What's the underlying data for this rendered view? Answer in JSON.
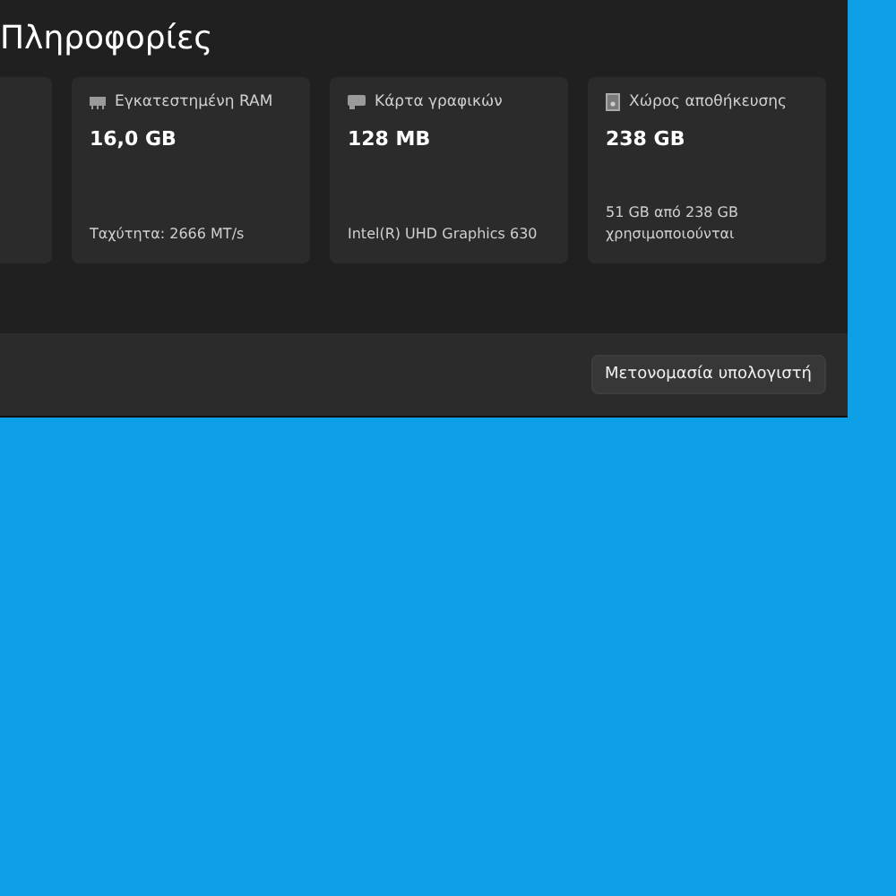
{
  "title": "Πληροφορίες",
  "cards": [
    {
      "kind": "ram",
      "label": "Εγκατεστημένη RAM",
      "value": "16,0 GB",
      "detail": "Ταχύτητα: 2666 MT/s"
    },
    {
      "kind": "graphics",
      "label": "Κάρτα γραφικών",
      "value": "128 MB",
      "detail": "Intel(R) UHD Graphics 630"
    },
    {
      "kind": "storage",
      "label": "Χώρος αποθήκευσης",
      "value": "238 GB",
      "detail": "51 GB από 238 GB χρησιμοποιούνται"
    }
  ],
  "footer": {
    "button": "Μετονομασία υπολογιστή"
  }
}
